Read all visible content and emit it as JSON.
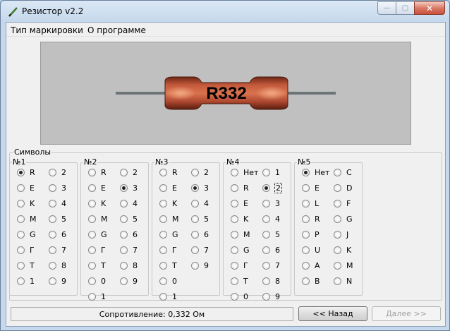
{
  "window": {
    "title": "Резистор v2.2",
    "controls": {
      "minimize": "—",
      "maximize": "▢",
      "close": "✕"
    }
  },
  "menu": [
    "Тип маркировки",
    "О программе"
  ],
  "preview": {
    "marking": "R332"
  },
  "symbols": {
    "title": "Символы",
    "groups": [
      {
        "title": "№1",
        "col1": [
          "R",
          "E",
          "K",
          "M",
          "G",
          "Г",
          "T",
          "1"
        ],
        "col2": [
          "2",
          "3",
          "4",
          "5",
          "6",
          "7",
          "8",
          "9"
        ],
        "selected": "R"
      },
      {
        "title": "№2",
        "col1": [
          "R",
          "E",
          "K",
          "M",
          "G",
          "Г",
          "T",
          "0",
          "1"
        ],
        "col2": [
          "2",
          "3",
          "4",
          "5",
          "6",
          "7",
          "8",
          "9"
        ],
        "selected": "3"
      },
      {
        "title": "№3",
        "col1": [
          "R",
          "E",
          "K",
          "M",
          "G",
          "Г",
          "T",
          "0",
          "1"
        ],
        "col2": [
          "2",
          "3",
          "4",
          "5",
          "6",
          "7",
          "9"
        ],
        "selected": "3"
      },
      {
        "title": "№4",
        "col1": [
          "Нет",
          "R",
          "E",
          "K",
          "M",
          "G",
          "Г",
          "T",
          "0"
        ],
        "col2": [
          "1",
          "2",
          "3",
          "4",
          "5",
          "6",
          "7",
          "8",
          "9"
        ],
        "selected": "2"
      },
      {
        "title": "№5",
        "col1": [
          "Нет",
          "E",
          "L",
          "R",
          "P",
          "U",
          "A",
          "B"
        ],
        "col2": [
          "C",
          "D",
          "F",
          "G",
          "J",
          "K",
          "M",
          "N"
        ],
        "selected": "Нет"
      }
    ]
  },
  "status": {
    "resistance": "Сопротивление: 0,332 Ом"
  },
  "buttons": {
    "back": "<< Назад",
    "next": "Далее >>"
  },
  "colors": {
    "body": "#b1503a",
    "highlight": "#f4a07a",
    "lead": "#6c7478",
    "preview_bg": "#c0c0c0"
  }
}
